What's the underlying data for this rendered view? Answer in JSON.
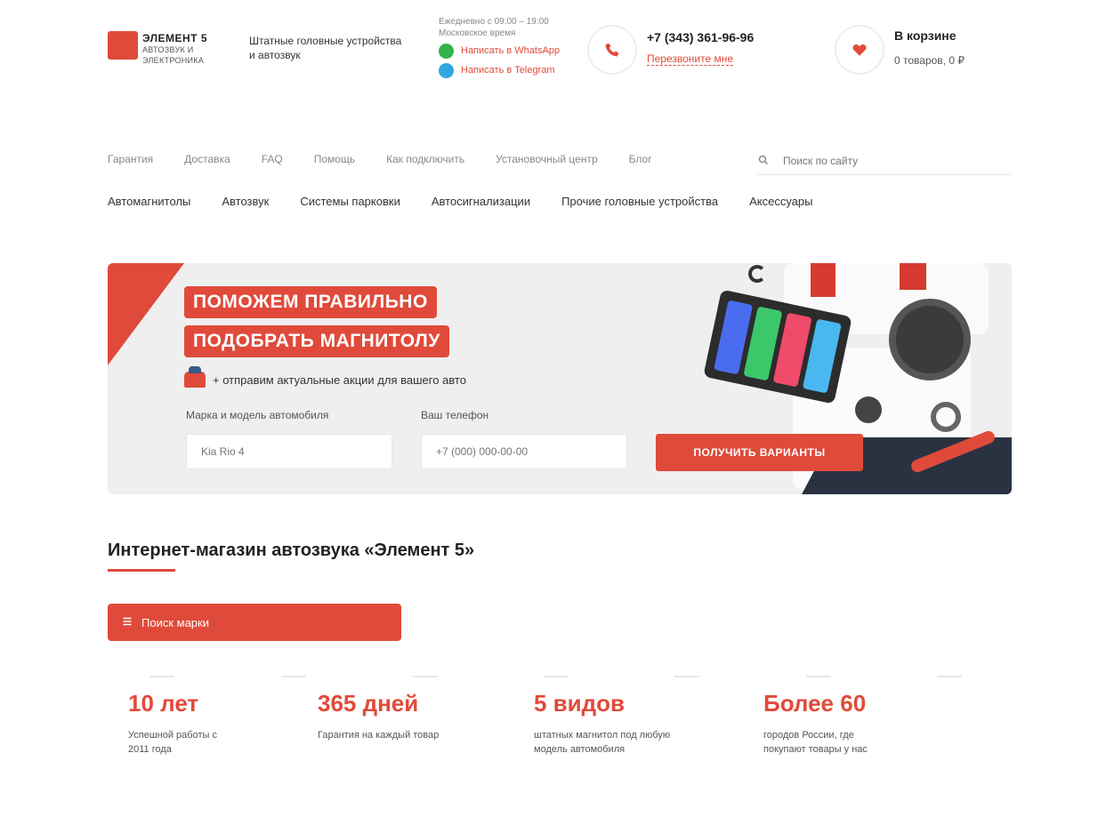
{
  "colors": {
    "accent": "#e04a3a",
    "dark": "#2a3242",
    "banner_bg": "#efefef"
  },
  "header": {
    "logo_name": "ЭЛЕМЕНТ 5",
    "logo_sub": "АВТОЗВУК И ЭЛЕКТРОНИКА",
    "tagline": "Штатные головные устройства и автозвук",
    "hours": "Ежедневно с 09:00 – 19:00 Московское время",
    "messengers": [
      {
        "label": "Написать в WhatsApp",
        "color": "#33b24a"
      },
      {
        "label": "Написать в Telegram",
        "color": "#2fa7e0"
      }
    ],
    "phone_icon": "phone-icon",
    "phone": "+7 (343) 361-96-96",
    "callback": "Перезвоните мне",
    "cart_icon": "heart-icon",
    "cart_title": "В корзине",
    "cart_count": "0 товаров, 0 ₽"
  },
  "nav_top": [
    "Гарантия",
    "Доставка",
    "FAQ",
    "Помощь",
    "Как подключить",
    "Установочный центр",
    "Блог"
  ],
  "search": {
    "icon": "search-icon",
    "placeholder": "Поиск по сайту"
  },
  "nav_main": [
    "Автомагнитолы",
    "Автозвук",
    "Системы парковки",
    "Автосигнализации",
    "Прочие головные устройства",
    "Аксессуары"
  ],
  "banner": {
    "headline1": "ПОМОЖЕМ ПРАВИЛЬНО",
    "headline2": "ПОДОБРАТЬ МАГНИТОЛУ",
    "offer": "+ отправим актуальные акции для вашего авто",
    "field1_label": "Марка и модель автомобиля",
    "field1_placeholder": "Kia Rio 4",
    "field2_label": "Ваш телефон",
    "field2_placeholder": "+7 (000) 000-00-00",
    "cta": "ПОЛУЧИТЬ ВАРИАНТЫ"
  },
  "section": {
    "title": "Интернет-магазин автозвука «Элемент 5»",
    "catalog_button": "Поиск марки",
    "catalog_icon": "menu-icon"
  },
  "stats": [
    {
      "value": "10 лет",
      "text": "Успешной работы с 2011 года"
    },
    {
      "value": "365 дней",
      "text": "Гарантия на каждый товар"
    },
    {
      "value": "5 видов",
      "text": "штатных магнитол под любую модель автомобиля"
    },
    {
      "value": "Более 60",
      "text": "городов России, где покупают товары у нас"
    }
  ]
}
